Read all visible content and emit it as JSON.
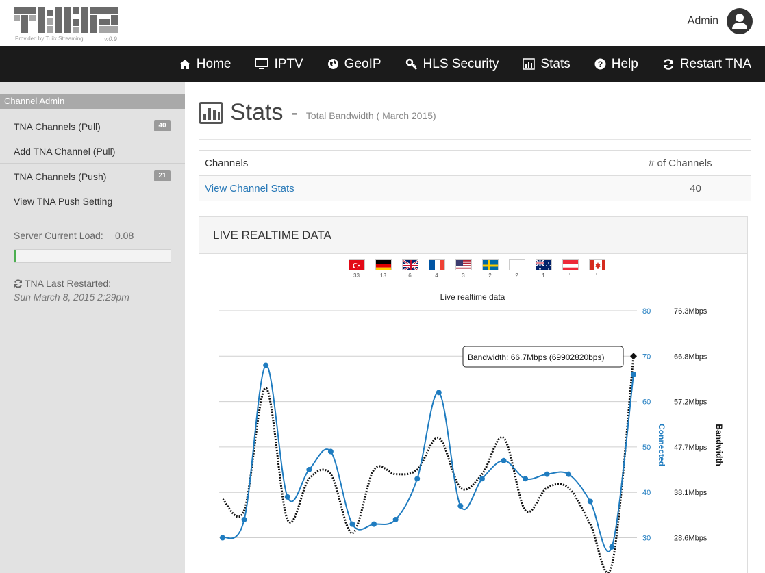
{
  "header": {
    "logo_sub": "Provided by Tuiix Streaming",
    "logo_version": "v.0.9",
    "user_name": "Admin"
  },
  "nav": {
    "items": [
      {
        "label": "Home",
        "icon": "home-icon"
      },
      {
        "label": "IPTV",
        "icon": "monitor-icon"
      },
      {
        "label": "GeoIP",
        "icon": "globe-icon"
      },
      {
        "label": "HLS Security",
        "icon": "key-icon"
      },
      {
        "label": "Stats",
        "icon": "bar-chart-icon"
      },
      {
        "label": "Help",
        "icon": "question-icon"
      },
      {
        "label": "Restart TNA",
        "icon": "refresh-icon"
      }
    ]
  },
  "sidebar": {
    "heading": "Channel Admin",
    "items": [
      {
        "label": "TNA Channels (Pull)",
        "badge": "40"
      },
      {
        "label": "Add TNA Channel (Pull)"
      },
      {
        "label": "TNA Channels (Push)",
        "badge": "21"
      },
      {
        "label": "View TNA Push Setting"
      }
    ],
    "load_label": "Server  Current  Load:",
    "load_value": "0.08",
    "load_fraction": 0.01,
    "restart_label": "TNA Last Restarted:",
    "restart_time": "Sun March 8, 2015 2:29pm"
  },
  "main": {
    "title": "Stats",
    "separator": "-",
    "subtitle": "Total Bandwidth ( March 2015)",
    "table": {
      "headers": [
        "Channels",
        "# of Channels"
      ],
      "row": {
        "link": "View Channel Stats",
        "count": "40"
      }
    },
    "panel_title": "LIVE REALTIME DATA",
    "flags": [
      {
        "country": "Turkey",
        "count": "33"
      },
      {
        "country": "Germany",
        "count": "13"
      },
      {
        "country": "United Kingdom",
        "count": "6"
      },
      {
        "country": "France",
        "count": "4"
      },
      {
        "country": "United States",
        "count": "3"
      },
      {
        "country": "Sweden",
        "count": "2"
      },
      {
        "country": "Unknown",
        "count": "2"
      },
      {
        "country": "Australia",
        "count": "1"
      },
      {
        "country": "Austria",
        "count": "1"
      },
      {
        "country": "Canada",
        "count": "1"
      }
    ]
  },
  "chart_data": {
    "type": "line",
    "title": "Live realtime data",
    "left_axis_label": "Connected",
    "right_axis_label": "Bandwidth",
    "connected_ticks": [
      "80",
      "70",
      "60",
      "50",
      "40",
      "30"
    ],
    "bandwidth_ticks": [
      "76.3Mbps",
      "66.8Mbps",
      "57.2Mbps",
      "47.7Mbps",
      "38.1Mbps",
      "28.6Mbps"
    ],
    "ylim": [
      24,
      80
    ],
    "series": [
      {
        "name": "Connected",
        "color": "#1f7cc0",
        "values": [
          30,
          34,
          68,
          39,
          45,
          49,
          33,
          33,
          34,
          43,
          62,
          37,
          43,
          47,
          43,
          44,
          44,
          38,
          28,
          66
        ]
      },
      {
        "name": "Bandwidth",
        "color": "#111111",
        "dashed": true,
        "values": [
          38.5,
          36,
          63,
          34,
          43,
          44,
          31,
          45,
          44,
          45,
          52,
          41,
          44,
          52,
          36,
          41,
          41,
          33,
          24,
          70
        ]
      }
    ],
    "tooltip": "Bandwidth: 66.7Mbps (69902820bps)"
  }
}
